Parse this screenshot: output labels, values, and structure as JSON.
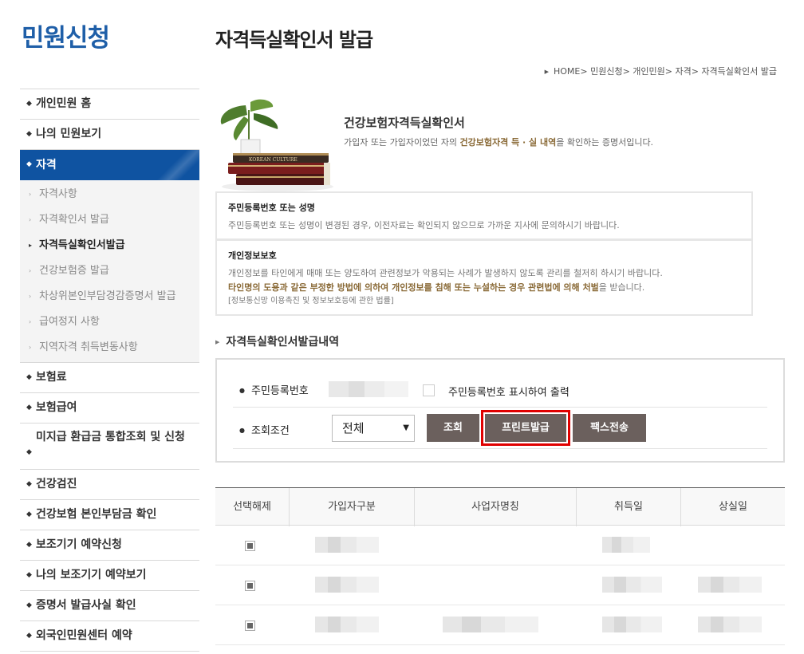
{
  "sidebar": {
    "title": "민원신청",
    "menu": [
      {
        "label": "개인민원 홈"
      },
      {
        "label": "나의 민원보기"
      },
      {
        "label": "자격"
      },
      {
        "label": "보험료"
      },
      {
        "label": "보험급여"
      },
      {
        "label": "미지급 환급금 통합조회 및 신청"
      },
      {
        "label": "건강검진"
      },
      {
        "label": "건강보험 본인부담금 확인"
      },
      {
        "label": "보조기기 예약신청"
      },
      {
        "label": "나의 보조기기 예약보기"
      },
      {
        "label": "증명서 발급사실 확인"
      },
      {
        "label": "외국인민원센터 예약"
      }
    ],
    "submenu": [
      {
        "label": "자격사항"
      },
      {
        "label": "자격확인서 발급"
      },
      {
        "label": "자격득실확인서발급"
      },
      {
        "label": "건강보험증 발급"
      },
      {
        "label": "차상위본인부담경감증명서 발급"
      },
      {
        "label": "급여정지 사항"
      },
      {
        "label": "지역자격 취득변동사항"
      }
    ]
  },
  "page": {
    "title": "자격득실확인서 발급",
    "breadcrumb": "HOME> 민원신청> 개인민원> 자격> 자격득실확인서 발급"
  },
  "intro": {
    "title": "건강보험자격득실확인서",
    "desc_pre": "가입자 또는 가입자이었던 자의 ",
    "desc_strong": "건강보험자격 득 · 실 내역",
    "desc_post": "을 확인하는 증명서입니다.",
    "book_label": "KOREAN CULTURE"
  },
  "notices": {
    "n1_title": "주민등록번호 또는 성명",
    "n1_text": "주민등록번호 또는 성명이 변경된 경우, 이전자료는 확인되지 않으므로 가까운 지사에 문의하시기 바랍니다.",
    "n2_title": "개인정보보호",
    "n2_text": "개인정보를 타인에게 매매 또는 양도하여 관련정보가 악용되는 사례가 발생하지 않도록 관리를 철저히 하시기 바랍니다.",
    "n2_strong": "타인명의 도용과 같은 부정한 방법에 의하여 개인정보를 침해 또는 누설하는 경우 관련법에 의해 처벌",
    "n2_strong_post": "을 받습니다.",
    "n2_law": "[정보통신망 이용촉진 및 정보보호등에 관한 법률]"
  },
  "history": {
    "title": "자격득실확인서발급내역",
    "rrn_label": "주민등록번호",
    "rrn_checkbox_label": "주민등록번호 표시하여 출력",
    "cond_label": "조회조건",
    "select_value": "전체",
    "btn_search": "조회",
    "btn_print": "프린트발급",
    "btn_fax": "팩스전송"
  },
  "table": {
    "headers": [
      "선택해제",
      "가입자구분",
      "사업자명칭",
      "취득일",
      "상실일"
    ],
    "row_count": 3
  }
}
